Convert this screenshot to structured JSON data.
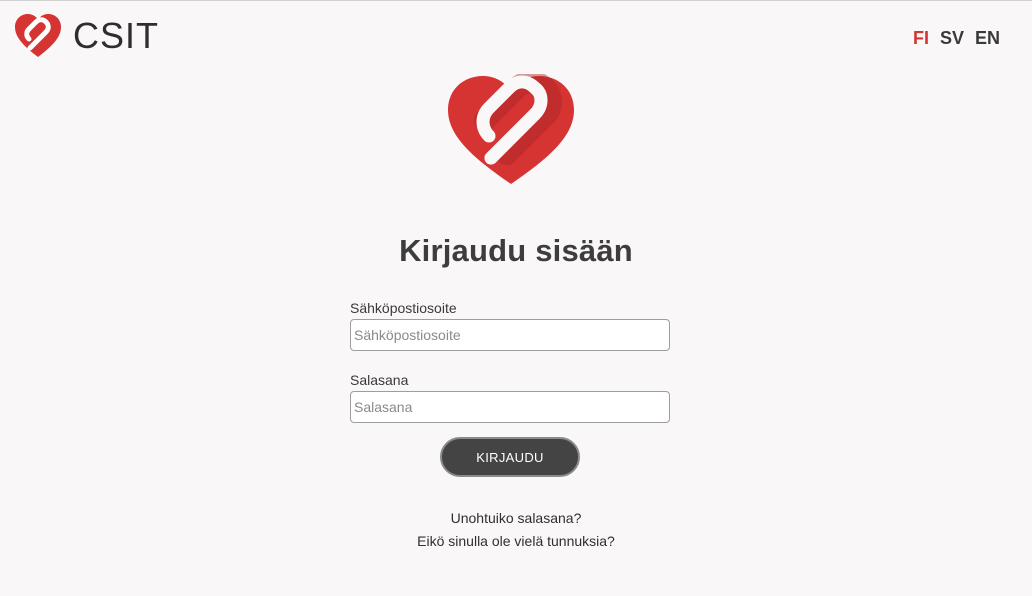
{
  "brand": {
    "name": "CSIT",
    "icon": "heart-logo-icon"
  },
  "colors": {
    "accent": "#d63333",
    "button": "#444444",
    "background": "#f9f7f7"
  },
  "languages": [
    {
      "code": "FI",
      "active": true
    },
    {
      "code": "SV",
      "active": false
    },
    {
      "code": "EN",
      "active": false
    }
  ],
  "login": {
    "title": "Kirjaudu sisään",
    "email": {
      "label": "Sähköpostiosoite",
      "placeholder": "Sähköpostiosoite",
      "value": ""
    },
    "password": {
      "label": "Salasana",
      "placeholder": "Salasana",
      "value": ""
    },
    "submit_label": "KIRJAUDU",
    "forgot_link": "Unohtuiko salasana?",
    "register_link": "Eikö sinulla ole vielä tunnuksia?"
  }
}
